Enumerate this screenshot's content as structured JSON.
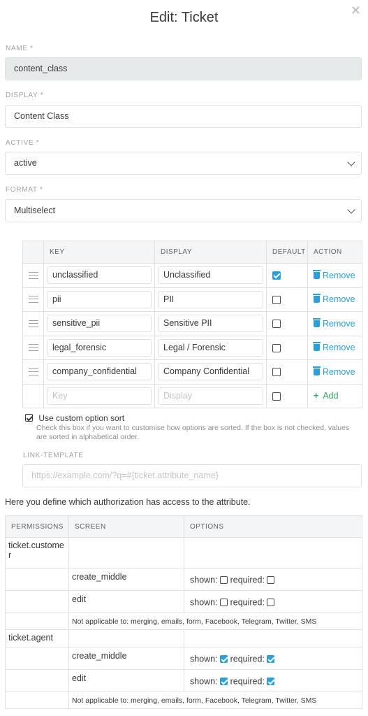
{
  "dialog": {
    "title": "Edit: Ticket",
    "close_icon": "close-icon"
  },
  "fields": {
    "name": {
      "label": "NAME *",
      "value": "content_class"
    },
    "display": {
      "label": "DISPLAY *",
      "value": "Content Class"
    },
    "active": {
      "label": "ACTIVE *",
      "value": "active"
    },
    "format": {
      "label": "FORMAT *",
      "value": "Multiselect"
    }
  },
  "options_table": {
    "headers": {
      "key": "KEY",
      "display": "DISPLAY",
      "default": "DEFAULT",
      "action": "ACTION"
    },
    "rows": [
      {
        "key": "unclassified",
        "display": "Unclassified",
        "default": true,
        "action": "Remove"
      },
      {
        "key": "pii",
        "display": "PII",
        "default": false,
        "action": "Remove"
      },
      {
        "key": "sensitive_pii",
        "display": "Sensitive PII",
        "default": false,
        "action": "Remove"
      },
      {
        "key": "legal_forensic",
        "display": "Legal / Forensic",
        "default": false,
        "action": "Remove"
      },
      {
        "key": "company_confidential",
        "display": "Company Confidential",
        "default": false,
        "action": "Remove"
      }
    ],
    "new_row": {
      "key_placeholder": "Key",
      "display_placeholder": "Display",
      "default": false,
      "action": "Add"
    }
  },
  "custom_sort": {
    "checked": true,
    "label": "Use custom option sort",
    "help": "Check this box if you want to customise how options are sorted. If the box is not checked, values are sorted in alphabetical order."
  },
  "link_template": {
    "label": "LINK-TEMPLATE",
    "placeholder": "https://example.com/?q=#{ticket.attribute_name}"
  },
  "permissions": {
    "intro": "Here you define which authorization has access to the attribute.",
    "headers": {
      "permissions": "PERMISSIONS",
      "screen": "SCREEN",
      "options": "OPTIONS"
    },
    "shown_label": "shown:",
    "required_label": "required:",
    "groups": [
      {
        "name": "ticket.customer",
        "screens": [
          {
            "screen": "create_middle",
            "shown": false,
            "required": false
          },
          {
            "screen": "edit",
            "shown": false,
            "required": false
          }
        ],
        "not_applicable": "Not applicable to: merging, emails, form, Facebook, Telegram, Twitter, SMS"
      },
      {
        "name": "ticket.agent",
        "screens": [
          {
            "screen": "create_middle",
            "shown": true,
            "required": true
          },
          {
            "screen": "edit",
            "shown": true,
            "required": true
          }
        ],
        "not_applicable": "Not applicable to: merging, emails, form, Facebook, Telegram, Twitter, SMS"
      }
    ]
  },
  "colors": {
    "link": "#2c9fd9",
    "add": "#38a46a",
    "checked": "#2c9fd9"
  }
}
